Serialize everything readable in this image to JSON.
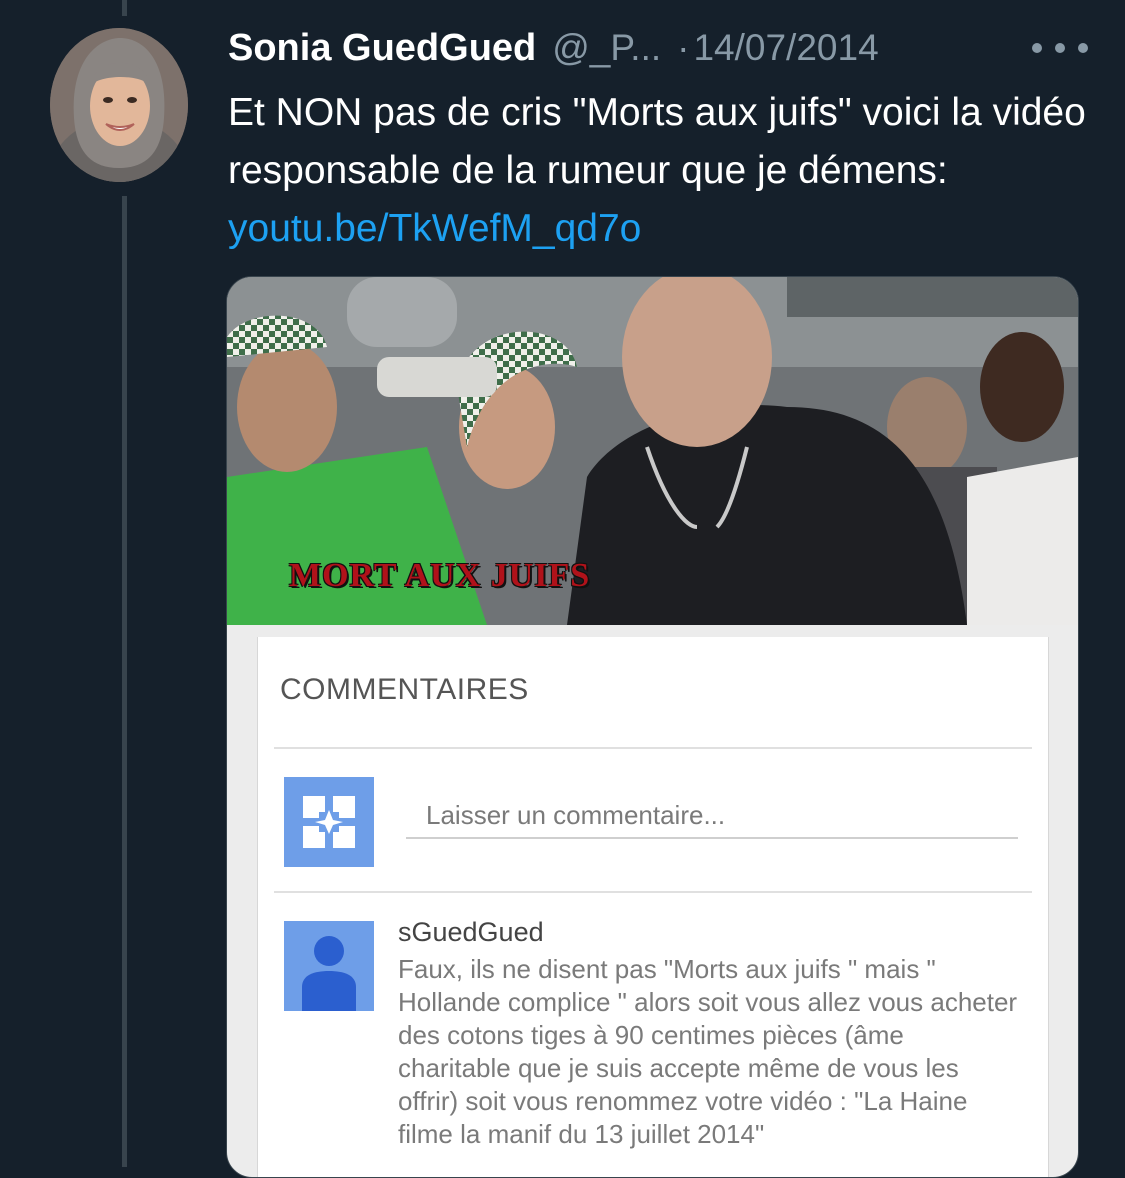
{
  "tweet": {
    "display_name": "Sonia GuedGued",
    "handle": "@_P...",
    "separator": "·",
    "date": "14/07/2014",
    "text_main": "Et NON pas de cris \"Morts aux juifs\" voici la vidéo responsable de la rumeur que je démens: ",
    "link": "youtu.be/TkWefM_qd7o"
  },
  "video": {
    "caption": "MORT AUX JUIFS"
  },
  "comments": {
    "title": "COMMENTAIRES",
    "input_placeholder": "Laisser un commentaire...",
    "items": [
      {
        "author": "sGuedGued",
        "text": "Faux, ils ne disent pas \"Morts aux juifs \" mais \" Hollande complice \" alors soit vous allez vous acheter des cotons tiges à 90 centimes pièces (âme charitable que je suis accepte même de vous les offrir) soit vous renommez votre vidéo : \"La Haine filme la manif du 13 juillet 2014\""
      }
    ]
  },
  "colors": {
    "background": "#15202b",
    "link": "#1da1f2",
    "muted": "#8899a6",
    "avatar_blue": "#6e9ee8",
    "caption_red": "#b0121a"
  },
  "icons": {
    "more": "more-horizontal-icon",
    "default_avatar": "default-user-icon",
    "blogger_avatar": "puzzle-avatar-icon"
  }
}
